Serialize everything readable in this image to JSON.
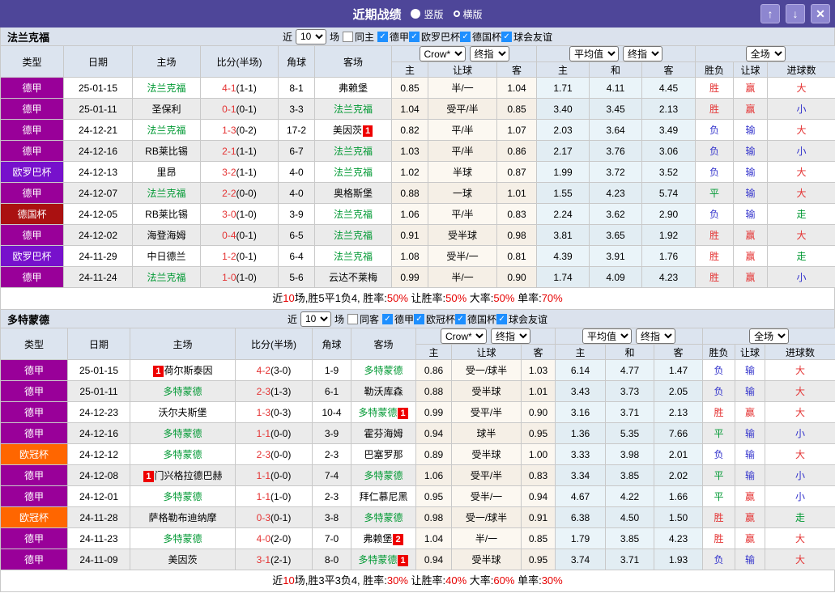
{
  "titlebar": {
    "title": "近期战绩",
    "vertical_label": "竖版",
    "horizontal_label": "横版",
    "up_icon": "↑",
    "down_icon": "↓",
    "close_icon": "✕"
  },
  "colors": {
    "titlebar_bg": "#4e4699",
    "titlebar_button_bg": "#8d86d0",
    "header_bg": "#dce4ef",
    "filterbar_bg": "#dbe2ed",
    "subject_team_green": "#009933",
    "score_red": "#e43333",
    "win_red": "#e43333",
    "lose_blue": "#3333cc",
    "draw_green": "#009933",
    "checkbox_blue": "#1e8fff",
    "badge_red": "#ee0000"
  },
  "type_colors": {
    "德甲": "#990099",
    "欧罗巴杯": "#7711cc",
    "德国杯": "#aa1111",
    "欧冠杯": "#ff6600"
  },
  "columns": {
    "type": "类型",
    "date": "日期",
    "home": "主场",
    "score": "比分(半场)",
    "corner": "角球",
    "away": "客场",
    "home_odds": "主",
    "handicap": "让球",
    "away_odds": "客",
    "avg_home": "主",
    "avg_draw": "和",
    "avg_away": "客",
    "result": "胜负",
    "handicap_result": "让球",
    "goals": "进球数"
  },
  "controls": {
    "bookmaker": "Crow*",
    "period1": "终指",
    "average": "平均值",
    "period2": "终指",
    "scope": "全场"
  },
  "filter_labels": {
    "prefix": "近",
    "suffix": "场"
  },
  "sections": [
    {
      "team": "法兰克福",
      "filter": {
        "count": "10",
        "same_label": "同主",
        "same_checked": false,
        "leagues": [
          "德甲",
          "欧罗巴杯",
          "德国杯",
          "球会友谊"
        ]
      },
      "rows": [
        {
          "type": "德甲",
          "date": "25-01-15",
          "home": {
            "text": "法兰克福",
            "green": true
          },
          "score": "4-1",
          "half": "(1-1)",
          "corner": "8-1",
          "away": {
            "text": "弗赖堡"
          },
          "odds": [
            "0.85",
            "半/一",
            "1.04"
          ],
          "avg": [
            "1.71",
            "4.11",
            "4.45"
          ],
          "results": [
            [
              "胜",
              "r"
            ],
            [
              "赢",
              "r"
            ],
            [
              "大",
              "r"
            ]
          ]
        },
        {
          "type": "德甲",
          "date": "25-01-11",
          "home": {
            "text": "圣保利"
          },
          "score": "0-1",
          "half": "(0-1)",
          "corner": "3-3",
          "away": {
            "text": "法兰克福",
            "green": true
          },
          "odds": [
            "1.04",
            "受平/半",
            "0.85"
          ],
          "avg": [
            "3.40",
            "3.45",
            "2.13"
          ],
          "results": [
            [
              "胜",
              "r"
            ],
            [
              "赢",
              "r"
            ],
            [
              "小",
              "b"
            ]
          ]
        },
        {
          "type": "德甲",
          "date": "24-12-21",
          "home": {
            "text": "法兰克福",
            "green": true
          },
          "score": "1-3",
          "half": "(0-2)",
          "corner": "17-2",
          "away": {
            "text": "美因茨",
            "badge": "1",
            "badge_pos": "after"
          },
          "odds": [
            "0.82",
            "平/半",
            "1.07"
          ],
          "avg": [
            "2.03",
            "3.64",
            "3.49"
          ],
          "results": [
            [
              "负",
              "b"
            ],
            [
              "输",
              "b"
            ],
            [
              "大",
              "r"
            ]
          ]
        },
        {
          "type": "德甲",
          "date": "24-12-16",
          "home": {
            "text": "RB莱比锡"
          },
          "score": "2-1",
          "half": "(1-1)",
          "corner": "6-7",
          "away": {
            "text": "法兰克福",
            "green": true
          },
          "odds": [
            "1.03",
            "平/半",
            "0.86"
          ],
          "avg": [
            "2.17",
            "3.76",
            "3.06"
          ],
          "results": [
            [
              "负",
              "b"
            ],
            [
              "输",
              "b"
            ],
            [
              "小",
              "b"
            ]
          ]
        },
        {
          "type": "欧罗巴杯",
          "date": "24-12-13",
          "home": {
            "text": "里昂"
          },
          "score": "3-2",
          "half": "(1-1)",
          "corner": "4-0",
          "away": {
            "text": "法兰克福",
            "green": true
          },
          "odds": [
            "1.02",
            "半球",
            "0.87"
          ],
          "avg": [
            "1.99",
            "3.72",
            "3.52"
          ],
          "results": [
            [
              "负",
              "b"
            ],
            [
              "输",
              "b"
            ],
            [
              "大",
              "r"
            ]
          ]
        },
        {
          "type": "德甲",
          "date": "24-12-07",
          "home": {
            "text": "法兰克福",
            "green": true
          },
          "score": "2-2",
          "half": "(0-0)",
          "corner": "4-0",
          "away": {
            "text": "奥格斯堡"
          },
          "odds": [
            "0.88",
            "一球",
            "1.01"
          ],
          "avg": [
            "1.55",
            "4.23",
            "5.74"
          ],
          "results": [
            [
              "平",
              "g"
            ],
            [
              "输",
              "b"
            ],
            [
              "大",
              "r"
            ]
          ]
        },
        {
          "type": "德国杯",
          "date": "24-12-05",
          "home": {
            "text": "RB莱比锡"
          },
          "score": "3-0",
          "half": "(1-0)",
          "corner": "3-9",
          "away": {
            "text": "法兰克福",
            "green": true
          },
          "odds": [
            "1.06",
            "平/半",
            "0.83"
          ],
          "avg": [
            "2.24",
            "3.62",
            "2.90"
          ],
          "results": [
            [
              "负",
              "b"
            ],
            [
              "输",
              "b"
            ],
            [
              "走",
              "g"
            ]
          ]
        },
        {
          "type": "德甲",
          "date": "24-12-02",
          "home": {
            "text": "海登海姆"
          },
          "score": "0-4",
          "half": "(0-1)",
          "corner": "6-5",
          "away": {
            "text": "法兰克福",
            "green": true
          },
          "odds": [
            "0.91",
            "受半球",
            "0.98"
          ],
          "avg": [
            "3.81",
            "3.65",
            "1.92"
          ],
          "results": [
            [
              "胜",
              "r"
            ],
            [
              "赢",
              "r"
            ],
            [
              "大",
              "r"
            ]
          ]
        },
        {
          "type": "欧罗巴杯",
          "date": "24-11-29",
          "home": {
            "text": "中日德兰"
          },
          "score": "1-2",
          "half": "(0-1)",
          "corner": "6-4",
          "away": {
            "text": "法兰克福",
            "green": true
          },
          "odds": [
            "1.08",
            "受半/一",
            "0.81"
          ],
          "avg": [
            "4.39",
            "3.91",
            "1.76"
          ],
          "results": [
            [
              "胜",
              "r"
            ],
            [
              "赢",
              "r"
            ],
            [
              "走",
              "g"
            ]
          ]
        },
        {
          "type": "德甲",
          "date": "24-11-24",
          "home": {
            "text": "法兰克福",
            "green": true
          },
          "score": "1-0",
          "half": "(1-0)",
          "corner": "5-6",
          "away": {
            "text": "云达不莱梅"
          },
          "odds": [
            "0.99",
            "半/一",
            "0.90"
          ],
          "avg": [
            "1.74",
            "4.09",
            "4.23"
          ],
          "results": [
            [
              "胜",
              "r"
            ],
            [
              "赢",
              "r"
            ],
            [
              "小",
              "b"
            ]
          ]
        }
      ],
      "summary": [
        [
          "近",
          "k"
        ],
        [
          "10",
          "r"
        ],
        [
          "场,胜5平1负4, 胜率:",
          "k"
        ],
        [
          "50%",
          "r"
        ],
        [
          " 让胜率:",
          "k"
        ],
        [
          "50%",
          "r"
        ],
        [
          " 大率:",
          "k"
        ],
        [
          "50%",
          "r"
        ],
        [
          " 单率:",
          "k"
        ],
        [
          "70%",
          "r"
        ]
      ]
    },
    {
      "team": "多特蒙德",
      "filter": {
        "count": "10",
        "same_label": "同客",
        "same_checked": false,
        "leagues": [
          "德甲",
          "欧冠杯",
          "德国杯",
          "球会友谊"
        ]
      },
      "rows": [
        {
          "type": "德甲",
          "date": "25-01-15",
          "home": {
            "text": "荷尔斯泰因",
            "badge": "1",
            "badge_pos": "before"
          },
          "score": "4-2",
          "half": "(3-0)",
          "corner": "1-9",
          "away": {
            "text": "多特蒙德",
            "green": true
          },
          "odds": [
            "0.86",
            "受一/球半",
            "1.03"
          ],
          "avg": [
            "6.14",
            "4.77",
            "1.47"
          ],
          "results": [
            [
              "负",
              "b"
            ],
            [
              "输",
              "b"
            ],
            [
              "大",
              "r"
            ]
          ]
        },
        {
          "type": "德甲",
          "date": "25-01-11",
          "home": {
            "text": "多特蒙德",
            "green": true
          },
          "score": "2-3",
          "half": "(1-3)",
          "corner": "6-1",
          "away": {
            "text": "勒沃库森"
          },
          "odds": [
            "0.88",
            "受半球",
            "1.01"
          ],
          "avg": [
            "3.43",
            "3.73",
            "2.05"
          ],
          "results": [
            [
              "负",
              "b"
            ],
            [
              "输",
              "b"
            ],
            [
              "大",
              "r"
            ]
          ]
        },
        {
          "type": "德甲",
          "date": "24-12-23",
          "home": {
            "text": "沃尔夫斯堡"
          },
          "score": "1-3",
          "half": "(0-3)",
          "corner": "10-4",
          "away": {
            "text": "多特蒙德",
            "green": true,
            "badge": "1",
            "badge_pos": "after"
          },
          "odds": [
            "0.99",
            "受平/半",
            "0.90"
          ],
          "avg": [
            "3.16",
            "3.71",
            "2.13"
          ],
          "results": [
            [
              "胜",
              "r"
            ],
            [
              "赢",
              "r"
            ],
            [
              "大",
              "r"
            ]
          ]
        },
        {
          "type": "德甲",
          "date": "24-12-16",
          "home": {
            "text": "多特蒙德",
            "green": true
          },
          "score": "1-1",
          "half": "(0-0)",
          "corner": "3-9",
          "away": {
            "text": "霍芬海姆"
          },
          "odds": [
            "0.94",
            "球半",
            "0.95"
          ],
          "avg": [
            "1.36",
            "5.35",
            "7.66"
          ],
          "results": [
            [
              "平",
              "g"
            ],
            [
              "输",
              "b"
            ],
            [
              "小",
              "b"
            ]
          ]
        },
        {
          "type": "欧冠杯",
          "date": "24-12-12",
          "home": {
            "text": "多特蒙德",
            "green": true
          },
          "score": "2-3",
          "half": "(0-0)",
          "corner": "2-3",
          "away": {
            "text": "巴塞罗那"
          },
          "odds": [
            "0.89",
            "受半球",
            "1.00"
          ],
          "avg": [
            "3.33",
            "3.98",
            "2.01"
          ],
          "results": [
            [
              "负",
              "b"
            ],
            [
              "输",
              "b"
            ],
            [
              "大",
              "r"
            ]
          ]
        },
        {
          "type": "德甲",
          "date": "24-12-08",
          "home": {
            "text": "门兴格拉德巴赫",
            "badge": "1",
            "badge_pos": "before"
          },
          "score": "1-1",
          "half": "(0-0)",
          "corner": "7-4",
          "away": {
            "text": "多特蒙德",
            "green": true
          },
          "odds": [
            "1.06",
            "受平/半",
            "0.83"
          ],
          "avg": [
            "3.34",
            "3.85",
            "2.02"
          ],
          "results": [
            [
              "平",
              "g"
            ],
            [
              "输",
              "b"
            ],
            [
              "小",
              "b"
            ]
          ]
        },
        {
          "type": "德甲",
          "date": "24-12-01",
          "home": {
            "text": "多特蒙德",
            "green": true
          },
          "score": "1-1",
          "half": "(1-0)",
          "corner": "2-3",
          "away": {
            "text": "拜仁慕尼黑"
          },
          "odds": [
            "0.95",
            "受半/一",
            "0.94"
          ],
          "avg": [
            "4.67",
            "4.22",
            "1.66"
          ],
          "results": [
            [
              "平",
              "g"
            ],
            [
              "赢",
              "r"
            ],
            [
              "小",
              "b"
            ]
          ]
        },
        {
          "type": "欧冠杯",
          "date": "24-11-28",
          "home": {
            "text": "萨格勒布迪纳摩"
          },
          "score": "0-3",
          "half": "(0-1)",
          "corner": "3-8",
          "away": {
            "text": "多特蒙德",
            "green": true
          },
          "odds": [
            "0.98",
            "受一/球半",
            "0.91"
          ],
          "avg": [
            "6.38",
            "4.50",
            "1.50"
          ],
          "results": [
            [
              "胜",
              "r"
            ],
            [
              "赢",
              "r"
            ],
            [
              "走",
              "g"
            ]
          ]
        },
        {
          "type": "德甲",
          "date": "24-11-23",
          "home": {
            "text": "多特蒙德",
            "green": true
          },
          "score": "4-0",
          "half": "(2-0)",
          "corner": "7-0",
          "away": {
            "text": "弗赖堡",
            "badge": "2",
            "badge_pos": "after"
          },
          "odds": [
            "1.04",
            "半/一",
            "0.85"
          ],
          "avg": [
            "1.79",
            "3.85",
            "4.23"
          ],
          "results": [
            [
              "胜",
              "r"
            ],
            [
              "赢",
              "r"
            ],
            [
              "大",
              "r"
            ]
          ]
        },
        {
          "type": "德甲",
          "date": "24-11-09",
          "home": {
            "text": "美因茨"
          },
          "score": "3-1",
          "half": "(2-1)",
          "corner": "8-0",
          "away": {
            "text": "多特蒙德",
            "green": true,
            "badge": "1",
            "badge_pos": "after"
          },
          "odds": [
            "0.94",
            "受半球",
            "0.95"
          ],
          "avg": [
            "3.74",
            "3.71",
            "1.93"
          ],
          "results": [
            [
              "负",
              "b"
            ],
            [
              "输",
              "b"
            ],
            [
              "大",
              "r"
            ]
          ]
        }
      ],
      "summary": [
        [
          "近",
          "k"
        ],
        [
          "10",
          "r"
        ],
        [
          "场,胜3平3负4, 胜率:",
          "k"
        ],
        [
          "30%",
          "r"
        ],
        [
          " 让胜率:",
          "k"
        ],
        [
          "40%",
          "r"
        ],
        [
          " 大率:",
          "k"
        ],
        [
          "60%",
          "r"
        ],
        [
          " 单率:",
          "k"
        ],
        [
          "30%",
          "r"
        ]
      ]
    }
  ]
}
